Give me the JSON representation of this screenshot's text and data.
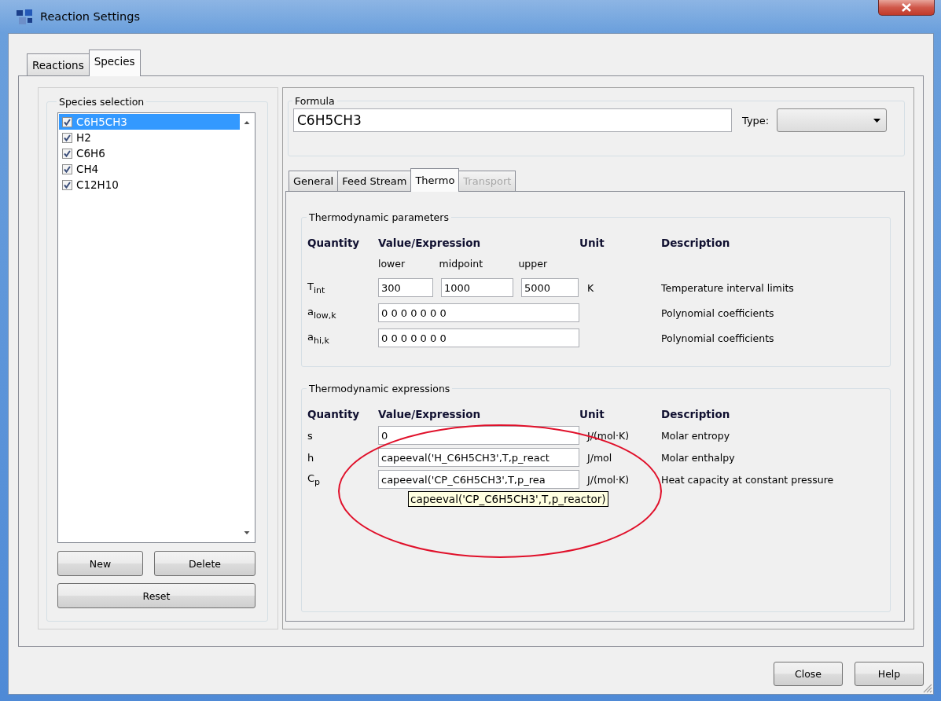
{
  "window": {
    "title": "Reaction Settings"
  },
  "tabs": [
    {
      "label": "Reactions",
      "selected": false
    },
    {
      "label": "Species",
      "selected": true
    }
  ],
  "species_selection": {
    "title": "Species selection",
    "items": [
      {
        "label": "C6H5CH3",
        "checked": true,
        "selected": true
      },
      {
        "label": "H2",
        "checked": true,
        "selected": false
      },
      {
        "label": "C6H6",
        "checked": true,
        "selected": false
      },
      {
        "label": "CH4",
        "checked": true,
        "selected": false
      },
      {
        "label": "C12H10",
        "checked": true,
        "selected": false
      }
    ],
    "buttons": [
      "New",
      "Delete",
      "Reset"
    ]
  },
  "formula": {
    "title": "Formula",
    "value": "C6H5CH3",
    "type_label": "Type:"
  },
  "detail_tabs": [
    {
      "label": "General",
      "selected": false,
      "disabled": false
    },
    {
      "label": "Feed Stream",
      "selected": false,
      "disabled": false
    },
    {
      "label": "Thermo",
      "selected": true,
      "disabled": false
    },
    {
      "label": "Transport",
      "selected": false,
      "disabled": true
    }
  ],
  "thermodynamic_parameters": {
    "title": "Thermodynamic parameters",
    "columns": [
      "Quantity",
      "Value/Expression",
      "Unit",
      "Description"
    ],
    "bound_labels": [
      "lower",
      "midpoint",
      "upper"
    ],
    "rows": [
      {
        "quantity": "T$_{int}$",
        "values": [
          "300",
          "1000",
          "5000"
        ],
        "unit": "K",
        "description": "Temperature interval limits"
      },
      {
        "quantity": "a$_{low,k}$",
        "values": [
          "0 0 0 0 0 0 0"
        ],
        "description": "Polynomial coefficients"
      },
      {
        "quantity": "a$_{hi,k}$",
        "values": [
          "0 0 0 0 0 0 0"
        ],
        "description": "Polynomial coefficients"
      }
    ]
  },
  "thermodynamic_expressions": {
    "title": "Thermodynamic expressions",
    "columns": [
      "Quantity",
      "Value/Expression",
      "Unit",
      "Description"
    ],
    "rows": [
      {
        "quantity": "s",
        "value": "0",
        "unit": "J/(mol·K)",
        "description": "Molar entropy"
      },
      {
        "quantity": "h",
        "value": "capeeval('H_C6H5CH3',T,p_react",
        "unit": "J/mol",
        "description": "Molar enthalpy"
      },
      {
        "quantity": "C$_{p}$",
        "value": "capeeval('CP_C6H5CH3',T,p_rea",
        "unit": "J/(mol·K)",
        "description": "Heat capacity at constant pressure",
        "tooltip": "capeeval('CP_C6H5CH3',T,p_reactor)"
      }
    ]
  },
  "buttons": [
    "Close",
    "Help"
  ]
}
